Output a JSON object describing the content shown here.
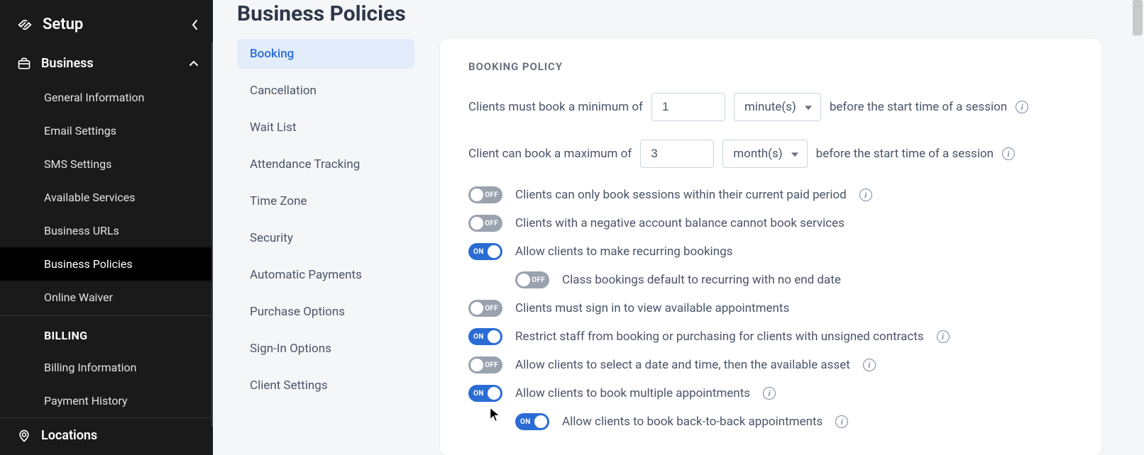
{
  "sidebar": {
    "header": "Setup",
    "sections": {
      "business": {
        "label": "Business",
        "items": [
          "General Information",
          "Email Settings",
          "SMS Settings",
          "Available Services",
          "Business URLs",
          "Business Policies",
          "Online Waiver"
        ],
        "billing_heading": "BILLING",
        "billing_items": [
          "Billing Information",
          "Payment History"
        ]
      },
      "locations": {
        "label": "Locations"
      }
    }
  },
  "page": {
    "title": "Business Policies"
  },
  "tabs": [
    "Booking",
    "Cancellation",
    "Wait List",
    "Attendance Tracking",
    "Time Zone",
    "Security",
    "Automatic Payments",
    "Purchase Options",
    "Sign-In Options",
    "Client Settings"
  ],
  "policy": {
    "heading": "BOOKING POLICY",
    "min_book": {
      "pre": "Clients must book a minimum of",
      "value": "1",
      "unit": "minute(s)",
      "post": "before the start time of a session"
    },
    "max_book": {
      "pre": "Client can book a maximum of",
      "value": "3",
      "unit": "month(s)",
      "post": "before the start time of a session"
    },
    "toggles": [
      {
        "on": false,
        "label": "Clients can only book sessions within their current paid period",
        "info": true,
        "indent": false
      },
      {
        "on": false,
        "label": "Clients with a negative account balance cannot book services",
        "info": false,
        "indent": false
      },
      {
        "on": true,
        "label": "Allow clients to make recurring bookings",
        "info": false,
        "indent": false
      },
      {
        "on": false,
        "label": "Class bookings default to recurring with no end date",
        "info": false,
        "indent": true
      },
      {
        "on": false,
        "label": "Clients must sign in to view available appointments",
        "info": false,
        "indent": false
      },
      {
        "on": true,
        "label": "Restrict staff from booking or purchasing for clients with unsigned contracts",
        "info": true,
        "indent": false
      },
      {
        "on": false,
        "label": "Allow clients to select a date and time, then the available asset",
        "info": true,
        "indent": false
      },
      {
        "on": true,
        "label": "Allow clients to book multiple appointments",
        "info": true,
        "indent": false
      },
      {
        "on": true,
        "label": "Allow clients to book back-to-back appointments",
        "info": true,
        "indent": true
      }
    ],
    "toggle_on_text": "ON",
    "toggle_off_text": "OFF"
  }
}
